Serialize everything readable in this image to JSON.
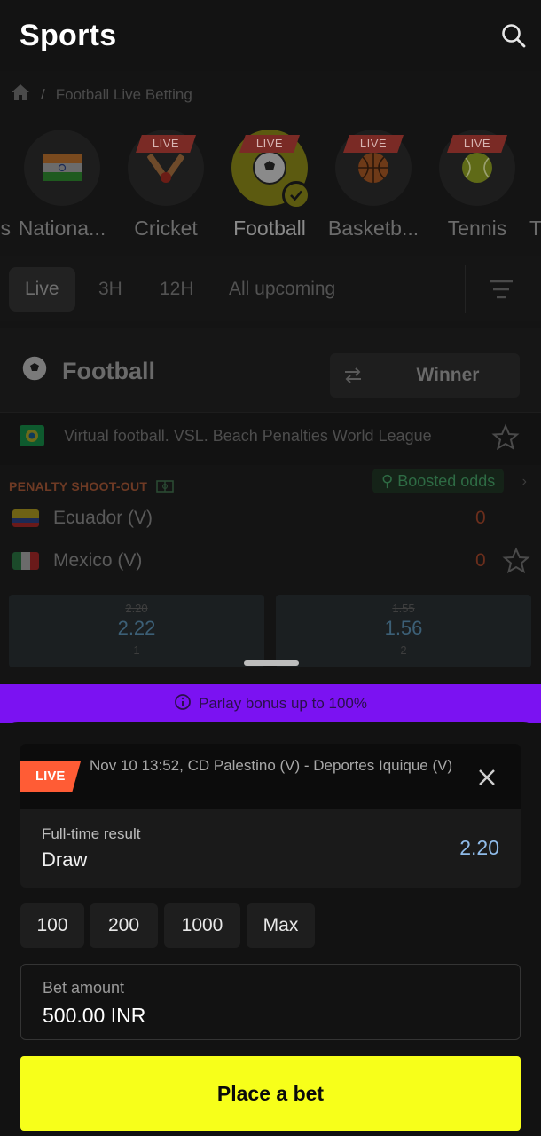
{
  "header": {
    "title": "Sports"
  },
  "breadcrumb": {
    "current": "Football Live Betting",
    "separator": "/"
  },
  "sports": [
    {
      "label": "s",
      "live": false
    },
    {
      "label": "Nationa...",
      "live": false
    },
    {
      "label": "Cricket",
      "live": true,
      "live_label": "LIVE"
    },
    {
      "label": "Football",
      "live": true,
      "live_label": "LIVE",
      "selected": true
    },
    {
      "label": "Basketb...",
      "live": true,
      "live_label": "LIVE"
    },
    {
      "label": "Tennis",
      "live": true,
      "live_label": "LIVE"
    },
    {
      "label": "T",
      "live": false
    }
  ],
  "filters": {
    "tabs": [
      "Live",
      "3H",
      "12H",
      "All upcoming"
    ],
    "active": "Live"
  },
  "section": {
    "title": "Football",
    "market_selector": "Winner"
  },
  "league": {
    "name": "Virtual football. VSL. Beach Penalties World League"
  },
  "match": {
    "type_label": "PENALTY SHOOT-OUT",
    "boosted_label": "Boosted odds",
    "home": {
      "name": "Ecuador (V)",
      "score": "0"
    },
    "away": {
      "name": "Mexico (V)",
      "score": "0"
    },
    "odds": [
      {
        "old": "2.20",
        "new": "2.22",
        "outcome": "1"
      },
      {
        "old": "1.55",
        "new": "1.56",
        "outcome": "2"
      }
    ]
  },
  "parlay": {
    "text": "Parlay bonus up to 100%"
  },
  "betslip": {
    "live_label": "LIVE",
    "event": "Nov 10 13:52, CD Palestino (V) - Deportes Iquique (V)",
    "market": "Full-time result",
    "selection": "Draw",
    "odd": "2.20",
    "quick_amounts": [
      "100",
      "200",
      "1000",
      "Max"
    ],
    "amount_label": "Bet amount",
    "amount_value": "500.00 INR",
    "place_label": "Place a bet"
  },
  "colors": {
    "accent_yellow": "#f7ff1a",
    "parlay_purple": "#7b12f2",
    "live_red": "#ff5c35",
    "odd_blue": "#8fbbe9"
  }
}
